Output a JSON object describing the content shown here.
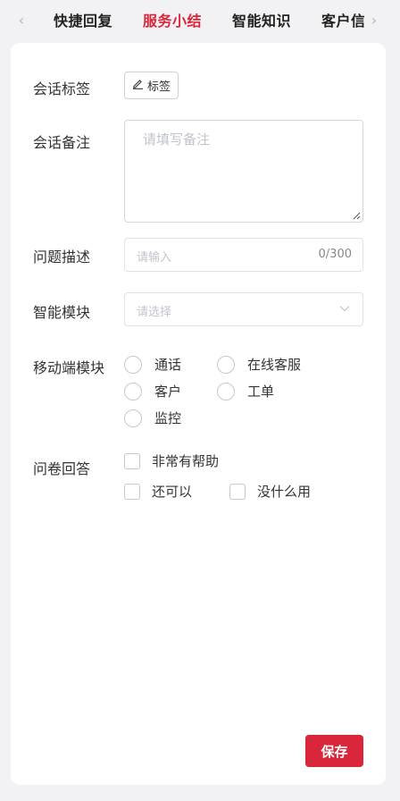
{
  "tabs": {
    "items": [
      {
        "label": "快捷回复"
      },
      {
        "label": "服务小结"
      },
      {
        "label": "智能知识"
      },
      {
        "label": "客户信息"
      }
    ],
    "active_color": "#d9263a",
    "left_arrow": "‹",
    "right_arrow": "›"
  },
  "form": {
    "tag": {
      "label": "会话标签",
      "button": "标签"
    },
    "note": {
      "label": "会话备注",
      "placeholder": "请填写备注"
    },
    "desc": {
      "label": "问题描述",
      "placeholder": "请输入",
      "counter": "0/300"
    },
    "module": {
      "label": "智能模块",
      "placeholder": "请选择"
    },
    "mobile": {
      "label": "移动端模块",
      "options": [
        "通话",
        "在线客服",
        "客户",
        "工单",
        "监控"
      ]
    },
    "survey": {
      "label": "问卷回答",
      "options": [
        "非常有帮助",
        "还可以",
        "没什么用"
      ]
    }
  },
  "save_label": "保存",
  "accent_color": "#d9263a"
}
